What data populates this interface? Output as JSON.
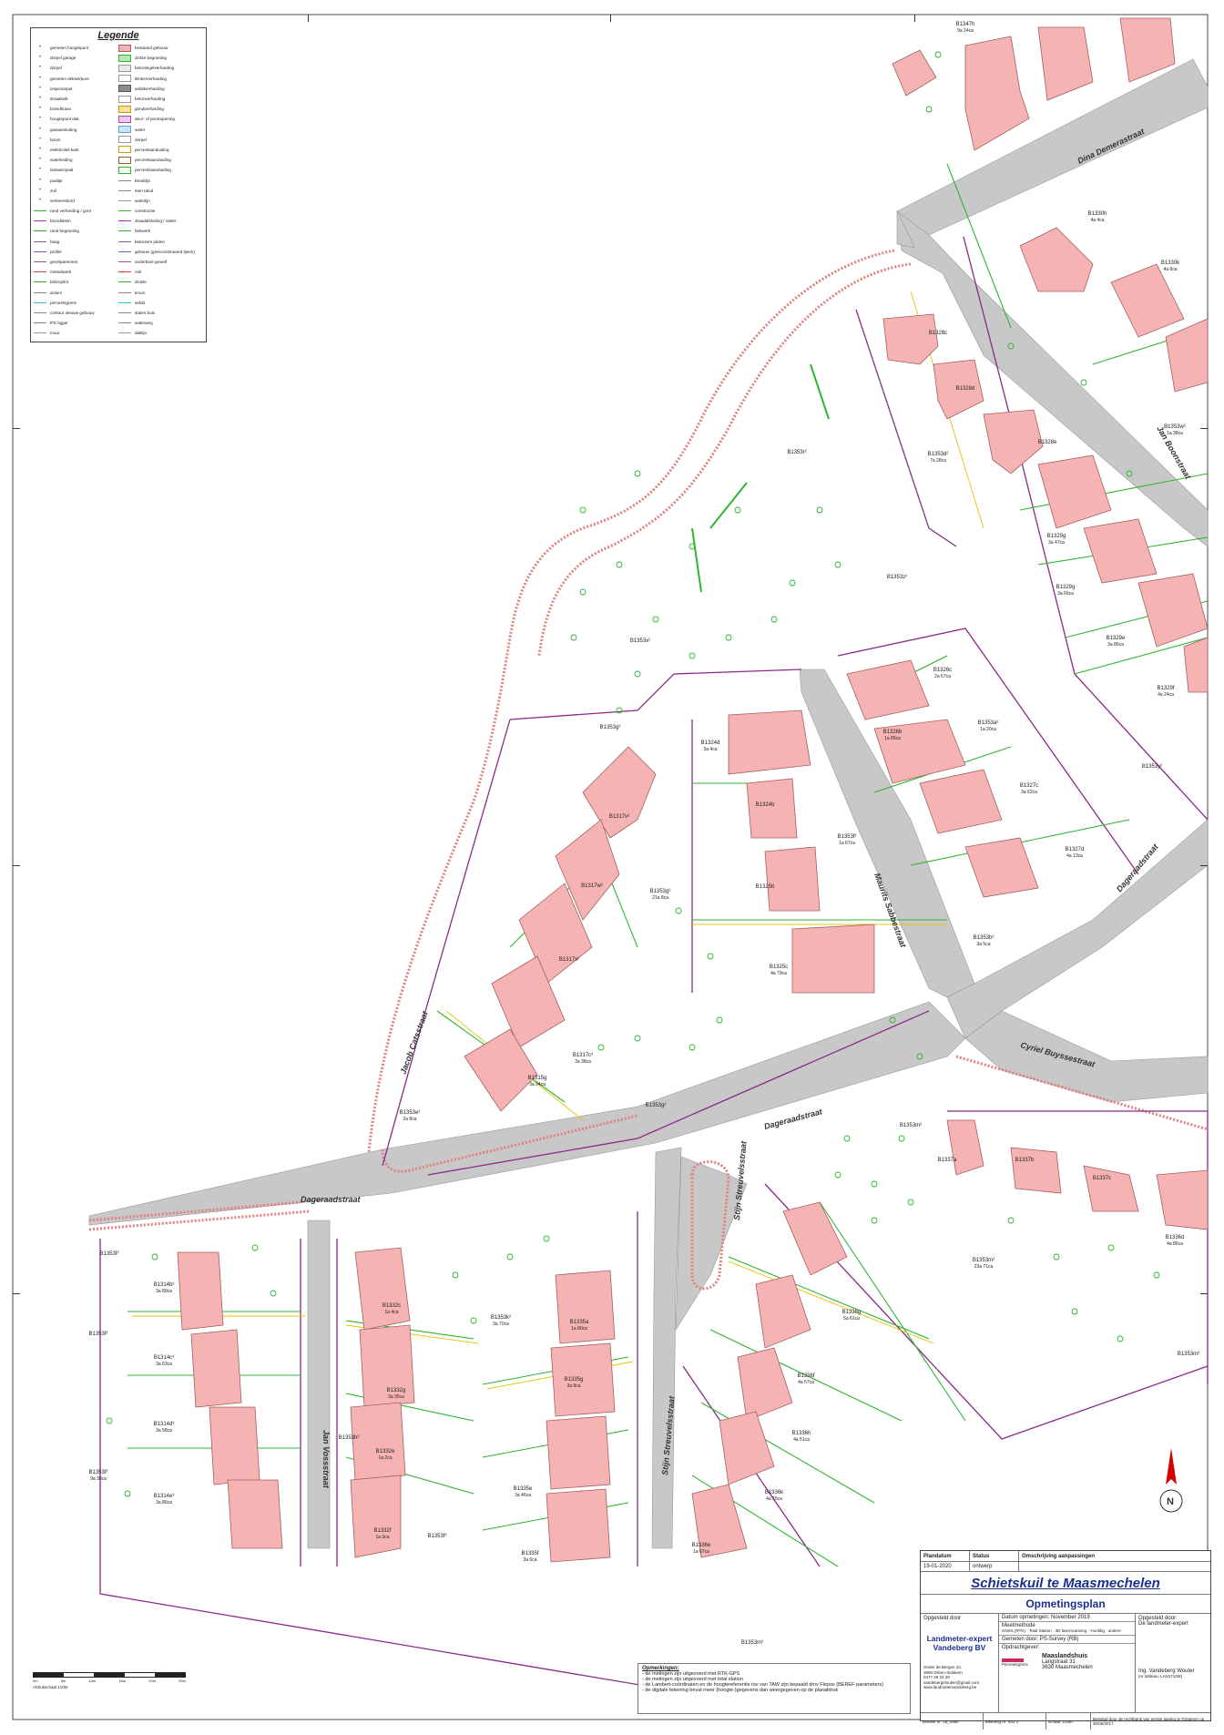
{
  "legend": {
    "title": "Legende",
    "left": [
      "gemeten hoogtepunt",
      "dorpel garage",
      "dorpel",
      "gemeten deksel/punt",
      "inspectieput",
      "straatkolk",
      "brandkraan",
      "hoogtepunt dak",
      "gasaansluiting",
      "boom",
      "elektriciteit kast",
      "waterleiding",
      "lantaarnpaal",
      "paaltje",
      "zuil",
      "verkeersbord",
      "rand verharding / goot",
      "boordsteen",
      "rand begroeiing",
      "haag",
      "profiel",
      "gevelparement",
      "metselwerk",
      "betonplint",
      "ardum",
      "perceelsgrens",
      "contour nieuwe gebouw",
      "IFE ligger",
      "muur"
    ],
    "right": [
      "bestaand gebouw",
      "dichte begroeiing",
      "betontegelverharding",
      "klinkerverharding",
      "asfaltverharding",
      "betonverharding",
      "grindverharding",
      "deur- of poortopening",
      "water",
      "dorpel",
      "perceelaanduiding",
      "perceelsaanduiding",
      "perceelsaanduiding",
      "breuklijn",
      "teen talud",
      "waterlijn",
      "constructie",
      "draadafsluiting / raster",
      "hekwerk",
      "betonnen platen",
      "gebouw (gereconstrueerd lijnen)",
      "onderbant gewelf",
      "nok",
      "drukte",
      "kroon",
      "asfalt",
      "stalen buis",
      "waterweg",
      "daklijn"
    ]
  },
  "streets": [
    {
      "name": "Dina Demerastraat"
    },
    {
      "name": "Jan Boonstraat"
    },
    {
      "name": "Dageraadstraat"
    },
    {
      "name": "Cyriel Buyssestraat"
    },
    {
      "name": "Maurits Sabbestraat"
    },
    {
      "name": "Jacob Catsstraat"
    },
    {
      "name": "Jan Vossstraat"
    },
    {
      "name": "Stijn Streuvelsstraat"
    }
  ],
  "parcels": [
    {
      "id": "B1347h",
      "area": "9a 24ca"
    },
    {
      "id": "B1330h",
      "area": "4a 4ca"
    },
    {
      "id": "B1330k",
      "area": "4a 8ca"
    },
    {
      "id": "B1328c",
      "area": ""
    },
    {
      "id": "B1328d",
      "area": ""
    },
    {
      "id": "B1328e",
      "area": ""
    },
    {
      "id": "B1353d²",
      "area": "7a 28ca"
    },
    {
      "id": "B1353w²",
      "area": "1a 38ca"
    },
    {
      "id": "B1329g",
      "area": "3a 47ca"
    },
    {
      "id": "B1329g",
      "area": "3a 66ca"
    },
    {
      "id": "B1329e",
      "area": "3a 86ca"
    },
    {
      "id": "B1329f",
      "area": "4a 24ca"
    },
    {
      "id": "B1353r²",
      "area": ""
    },
    {
      "id": "B1353z²",
      "area": ""
    },
    {
      "id": "B1353x²",
      "area": ""
    },
    {
      "id": "B1326c",
      "area": "2a 67ca"
    },
    {
      "id": "B1326b",
      "area": "1a 85ca"
    },
    {
      "id": "B1353a³",
      "area": "1a 20ca"
    },
    {
      "id": "B1327c",
      "area": "3a 62ca"
    },
    {
      "id": "B1327d",
      "area": "4a 13ca"
    },
    {
      "id": "B1353y²",
      "area": ""
    },
    {
      "id": "B1353b³",
      "area": "3a 5ca"
    },
    {
      "id": "B1353g²",
      "area": ""
    },
    {
      "id": "B1324d",
      "area": "3a 4ca"
    },
    {
      "id": "B1324b",
      "area": ""
    },
    {
      "id": "B1353f²",
      "area": "1a 67ca"
    },
    {
      "id": "B1325b",
      "area": ""
    },
    {
      "id": "B1325c",
      "area": "4a 79ca"
    },
    {
      "id": "B1317v²",
      "area": ""
    },
    {
      "id": "B1353g²",
      "area": "21a 8ca"
    },
    {
      "id": "B1317w²",
      "area": ""
    },
    {
      "id": "B1317x²",
      "area": ""
    },
    {
      "id": "B1317c³",
      "area": "3a 38ca"
    },
    {
      "id": "B1315g",
      "area": "3a 24ca"
    },
    {
      "id": "B1353e²",
      "area": "2a 8ca"
    },
    {
      "id": "B1353g²",
      "area": ""
    },
    {
      "id": "B1353m²",
      "area": ""
    },
    {
      "id": "B1337a",
      "area": ""
    },
    {
      "id": "B1337b",
      "area": ""
    },
    {
      "id": "B1337c",
      "area": ""
    },
    {
      "id": "B1336d",
      "area": "4a 86ca"
    },
    {
      "id": "B1353m²",
      "area": "23a 71ca"
    },
    {
      "id": "B1353m²",
      "area": ""
    },
    {
      "id": "B1336g",
      "area": "5a 61ca"
    },
    {
      "id": "B1336f",
      "area": "4a 57ca"
    },
    {
      "id": "B1336h",
      "area": "4a 51ca"
    },
    {
      "id": "B1336k",
      "area": "4a 15ca"
    },
    {
      "id": "B1336e",
      "area": "1a 67ca"
    },
    {
      "id": "B1353m²",
      "area": ""
    },
    {
      "id": "B1353f²",
      "area": ""
    },
    {
      "id": "B1314b³",
      "area": "3a 89ca"
    },
    {
      "id": "B1314c³",
      "area": "3a 63ca"
    },
    {
      "id": "B1314d³",
      "area": "3a 58ca"
    },
    {
      "id": "B1314e³",
      "area": "3a 86ca"
    },
    {
      "id": "B1353f²",
      "area": ""
    },
    {
      "id": "B1353f²",
      "area": "9a 38ca"
    },
    {
      "id": "B1332c",
      "area": "1a 4ca"
    },
    {
      "id": "B1332g",
      "area": "3a 35ca"
    },
    {
      "id": "B1332e",
      "area": "1a 2ca"
    },
    {
      "id": "B1332f",
      "area": "1a 3ca"
    },
    {
      "id": "B1353h²",
      "area": ""
    },
    {
      "id": "B1353f²",
      "area": ""
    },
    {
      "id": "B1353k²",
      "area": "3a 70ca"
    },
    {
      "id": "B1335a",
      "area": "1a 80ca"
    },
    {
      "id": "B1335g",
      "area": "3a 9ca"
    },
    {
      "id": "B1335e",
      "area": "3a 46ca"
    },
    {
      "id": "B1335f",
      "area": "3a 6ca"
    }
  ],
  "scale": {
    "ticks": [
      "0m",
      "5m",
      "10m",
      "15m",
      "20m",
      "25m"
    ],
    "label": "Afdrukschaal 1/250"
  },
  "notes": {
    "title": "Opmerkingen:",
    "lines": [
      "- de metingen zijn uitgevoerd met RTK-GPS",
      "- de metingen zijn uitgevoerd met total station",
      "- de Lambert-coördinaten en de hoogtereferentie tov van TAW zijn bepaald dmv Flepos (BEREF-parameters)",
      "- de digitale tekening bevat meer (hoogte-)gegevens dan weergegeven op de planafdruk"
    ]
  },
  "titleblock": {
    "col_plandatum": "Plandatum",
    "col_status": "Status",
    "col_omschrijving": "Omschrijving aanpassingen",
    "plandatum": "19-01-2020",
    "status": "ontwerp",
    "project": "Schietskuil te Maasmechelen",
    "subtitle": "Opmetingsplan",
    "opgesteld_label": "Opgesteld door",
    "company_line1": "Landmeter-expert",
    "company_line2": "Vandeberg BV",
    "company_addr1": "Onder de Bergen 10,",
    "company_addr2": "3680 Dilsen-Stokkem",
    "company_tel": "0477 49 22 29",
    "company_mail": "vandebergeloutier@gmail.com",
    "company_web": "www.landmetervandeberg.be",
    "datum_opmetingen": "Datum opmetingen: November 2019",
    "meetmethode_label": "Meetmethode",
    "meetmethode_opts": "GNSS (RTK) · Total Station · 3D laserscanning · Hoofdig · andere",
    "gemeten_door": "Gemeten door: PS-Survey (RB)",
    "opdrachtgever_label": "Opdrachtgever:",
    "opdrachtgever": "Maaslandshuis",
    "opdr_addr1": "Langstraat 31",
    "opdr_addr2": "3630 Maasmechelen",
    "legend_swatch_label": "Perceelsgrens",
    "right_opgesteld": "Opgesteld door:",
    "right_opgesteld2": "De landmeter-expert",
    "signer": "Ing. Vandeberg Wouter",
    "signer2": "(nr tableau: LAN171/58)",
    "dossier": "dossier nr: 18_0880",
    "tekening": "tekening nr: 001-1",
    "schaal": "schaal: 1/250",
    "beedigd": "Beëdigd door de rechtbank van eerste aanleg te Tongeren op 30/06/2017"
  },
  "colors": {
    "building": "#f6b3b3",
    "building_edge": "#a06060",
    "road": "#c8c8c8",
    "parcel": "#8a2a8a",
    "green": "#2fb52f",
    "yellow": "#e3c400",
    "sidewalk": "#e08080"
  }
}
